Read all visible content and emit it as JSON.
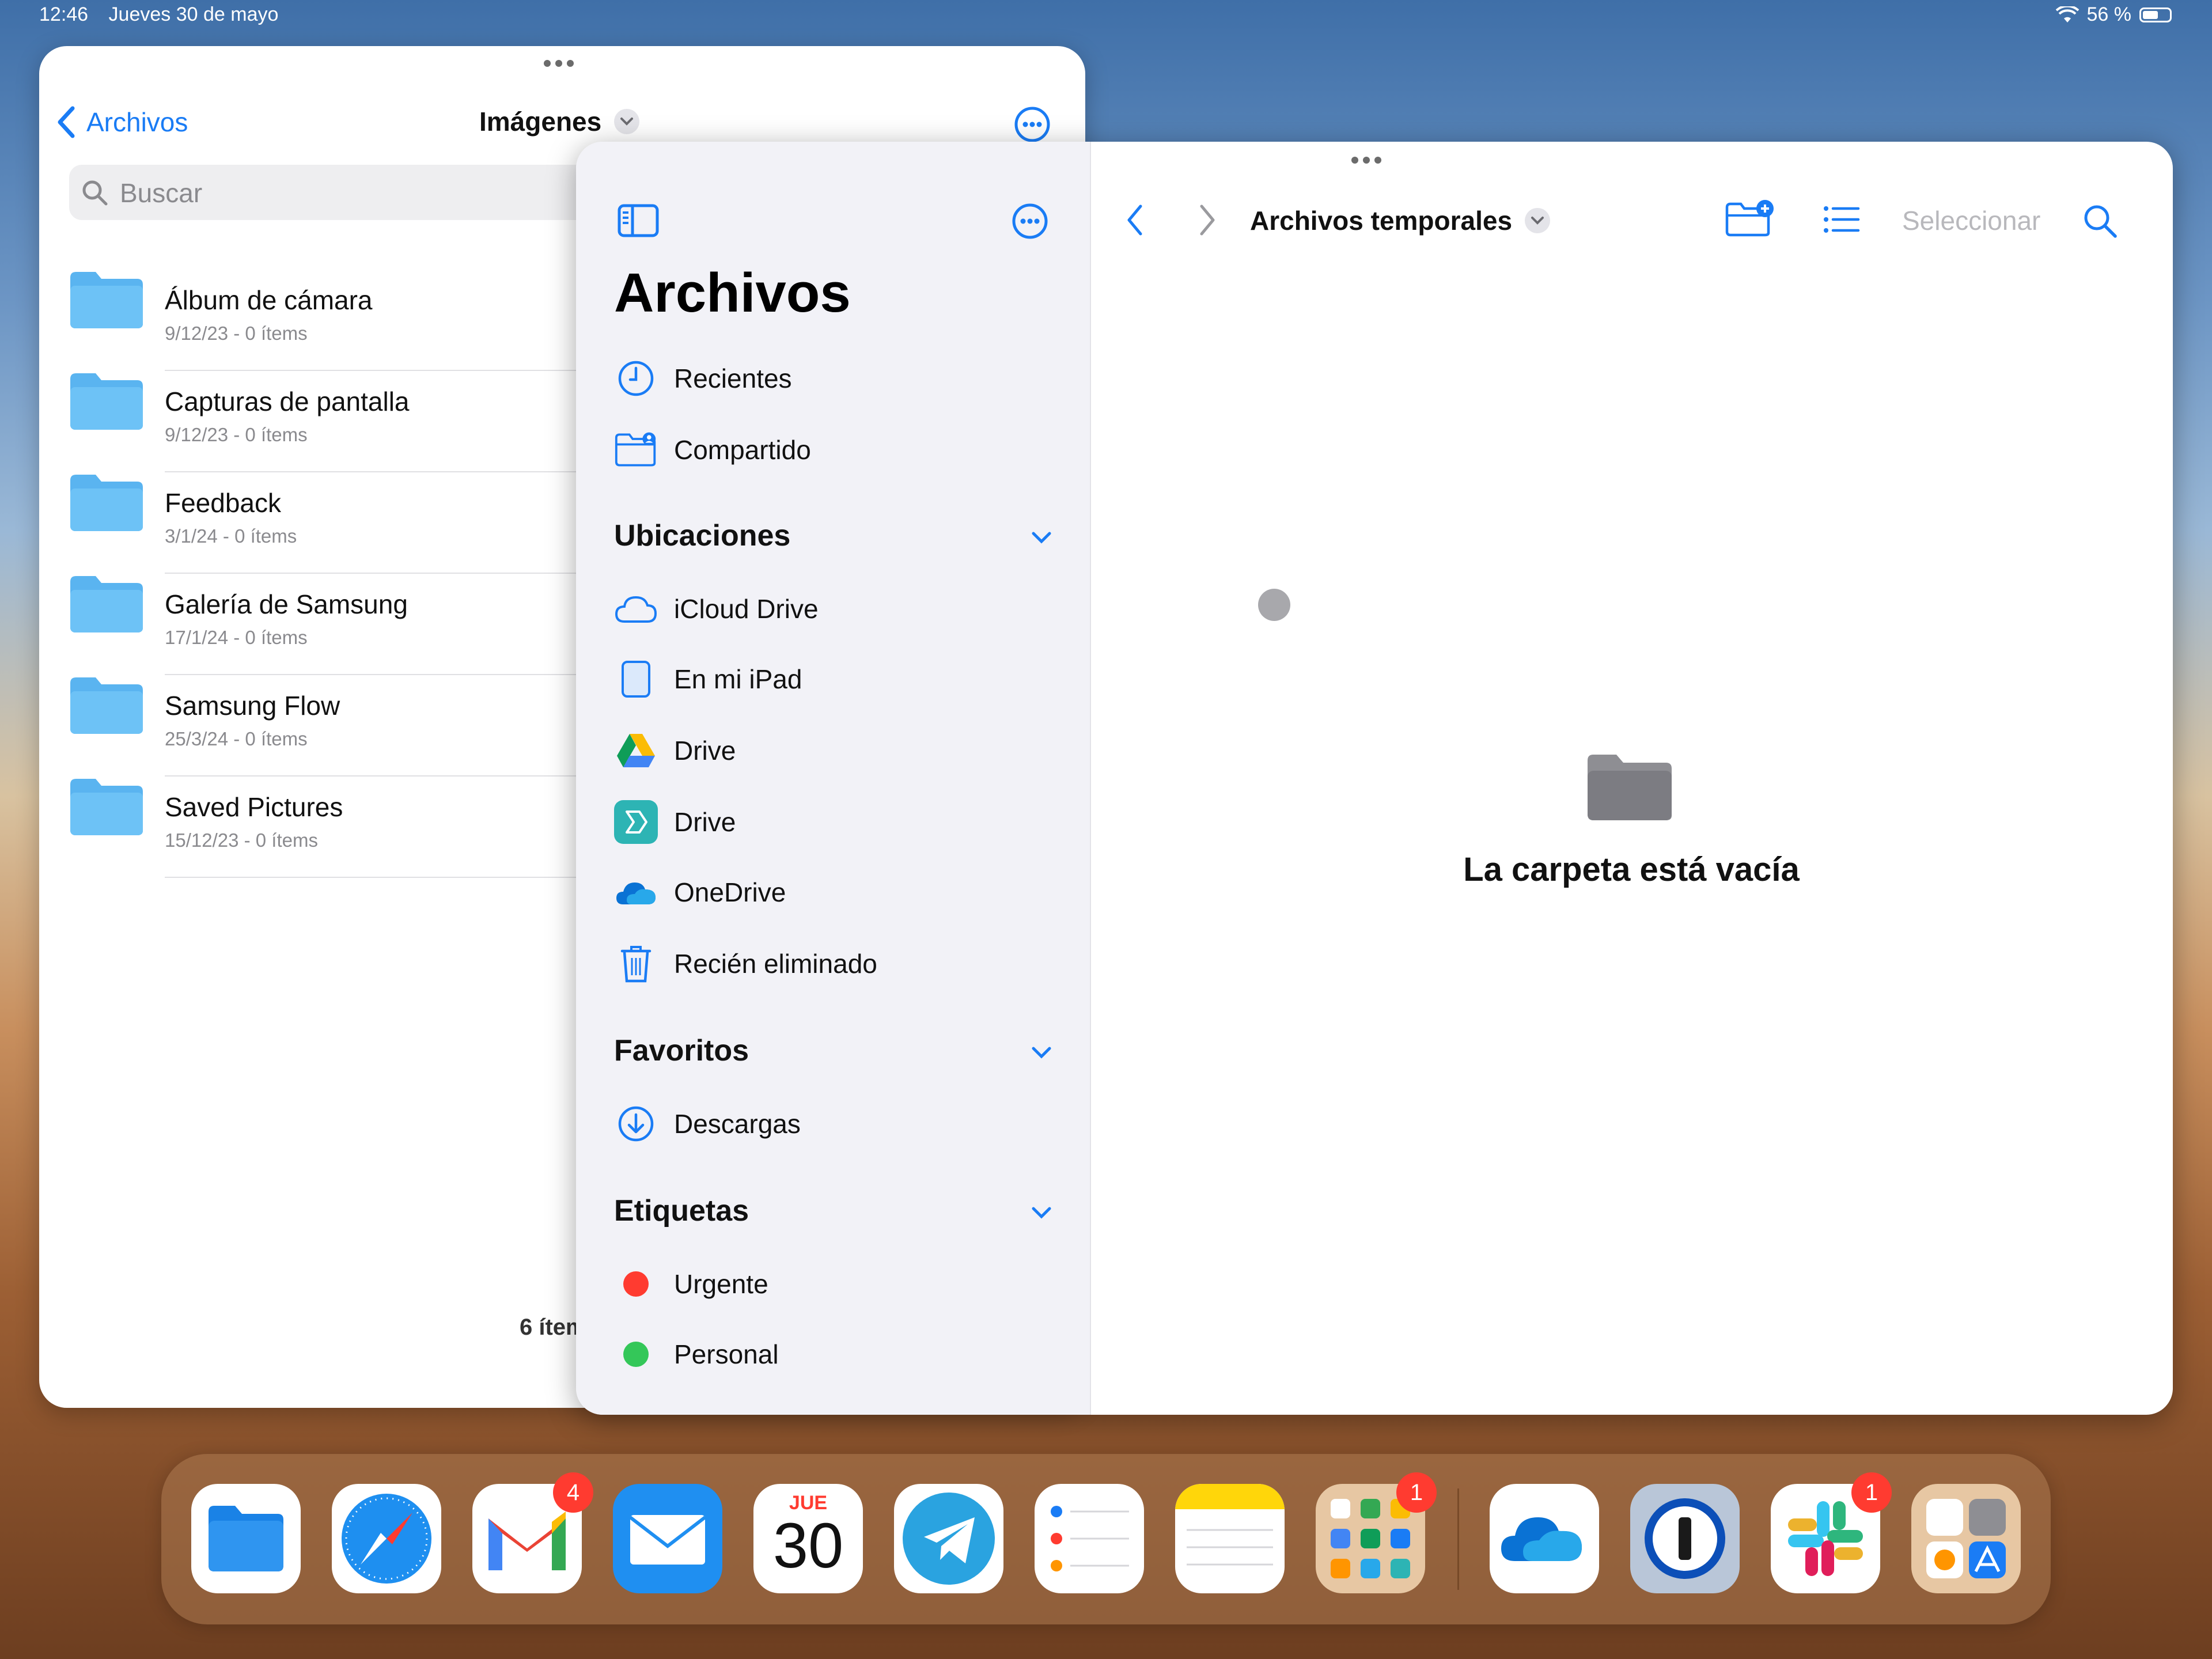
{
  "status_bar": {
    "time": "12:46",
    "date": "Jueves 30 de mayo",
    "battery": "56 %"
  },
  "back_window": {
    "back_label": "Archivos",
    "title": "Imágenes",
    "search_placeholder": "Buscar",
    "items_count": "6 ítem",
    "folders": [
      {
        "name": "Álbum de cámara",
        "meta": "9/12/23 - 0 ítems"
      },
      {
        "name": "Capturas de pantalla",
        "meta": "9/12/23 - 0 ítems"
      },
      {
        "name": "Feedback",
        "meta": "3/1/24 - 0 ítems"
      },
      {
        "name": "Galería de Samsung",
        "meta": "17/1/24 - 0 ítems"
      },
      {
        "name": "Samsung Flow",
        "meta": "25/3/24 - 0 ítems"
      },
      {
        "name": "Saved Pictures",
        "meta": "15/12/23 - 0 ítems"
      }
    ]
  },
  "sidebar": {
    "title": "Archivos",
    "recents": "Recientes",
    "shared": "Compartido",
    "locations_header": "Ubicaciones",
    "locations": [
      "iCloud Drive",
      "En mi iPad",
      "Drive",
      "Drive",
      "OneDrive",
      "Recién eliminado"
    ],
    "favorites_header": "Favoritos",
    "favorites": [
      "Descargas"
    ],
    "tags_header": "Etiquetas",
    "tags": [
      {
        "label": "Urgente",
        "color": "#ff3b30"
      },
      {
        "label": "Personal",
        "color": "#34c759"
      }
    ]
  },
  "content": {
    "folder_title": "Archivos temporales",
    "select_label": "Seleccionar",
    "empty_message": "La carpeta está vacía"
  },
  "dock": {
    "calendar_day": "JUE",
    "calendar_date": "30",
    "gmail_badge": "4",
    "folder_badge": "1",
    "slack_badge": "1"
  },
  "colors": {
    "accent": "#1a7cf5",
    "folder": "#5ab4f0"
  }
}
